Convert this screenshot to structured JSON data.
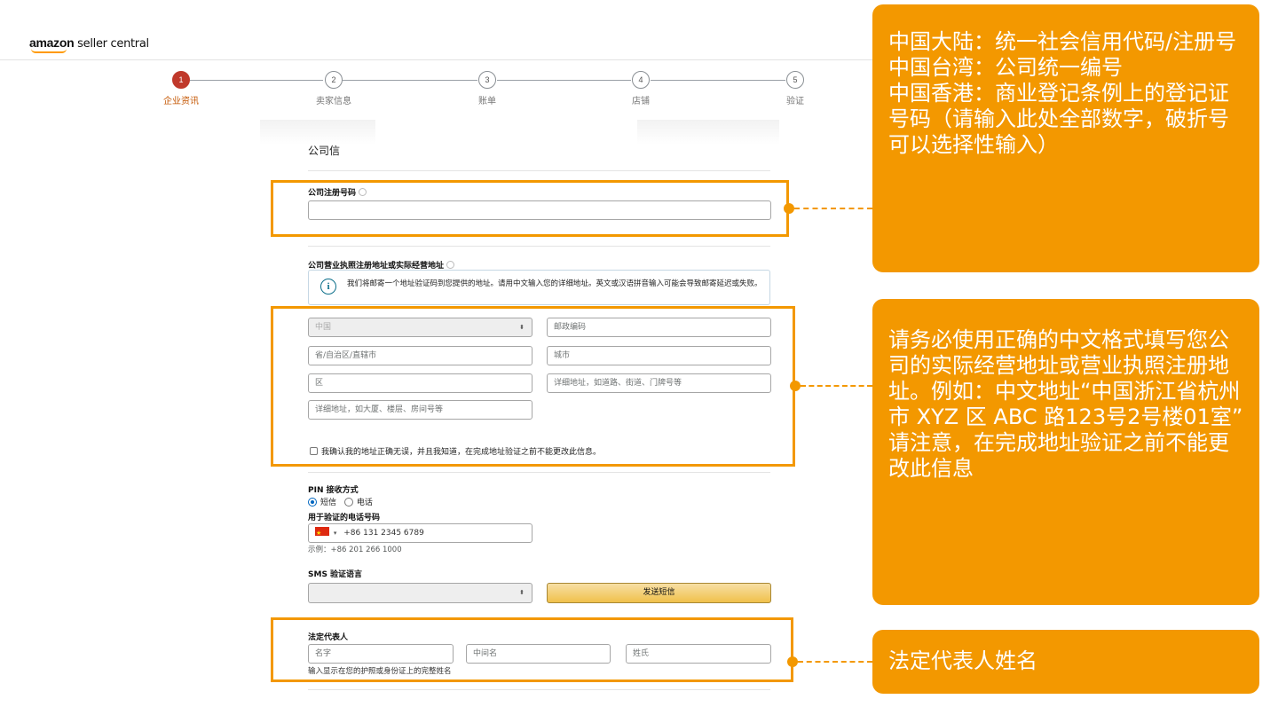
{
  "header": {
    "logo_brand": "amazon",
    "logo_rest": " seller central"
  },
  "stepper": {
    "steps": [
      {
        "num": "1",
        "label": "企业资讯",
        "active": true
      },
      {
        "num": "2",
        "label": "卖家信息",
        "active": false
      },
      {
        "num": "3",
        "label": "账单",
        "active": false
      },
      {
        "num": "4",
        "label": "店铺",
        "active": false
      },
      {
        "num": "5",
        "label": "验证",
        "active": false
      }
    ]
  },
  "form": {
    "section_title": "公司信",
    "registration_label": "公司注册号码",
    "registration_value": "",
    "address_label": "公司营业执照注册地址或实际经营地址",
    "info_message": "我们将邮寄一个地址验证码到您提供的地址。请用中文输入您的详细地址。英文或汉语拼音输入可能会导致邮寄延迟或失败。",
    "country_value": "中国",
    "postal_placeholder": "邮政编码",
    "province_placeholder": "省/自治区/直辖市",
    "city_placeholder": "城市",
    "district_placeholder": "区",
    "street_placeholder": "详细地址，如道路、街道、门牌号等",
    "building_placeholder": "详细地址，如大厦、楼层、房间号等",
    "confirm_checkbox": "我确认我的地址正确无误，并且我知道，在完成地址验证之前不能更改此信息。",
    "pin_label": "PIN 接收方式",
    "pin_options": [
      "短信",
      "电话"
    ],
    "phone_label": "用于验证的电话号码",
    "phone_value": "+86 131 2345 6789",
    "phone_example": "示例：+86 201 266 1000",
    "sms_lang_label": "SMS 验证语言",
    "sms_lang_value": "",
    "send_button": "发送短信",
    "legal_rep_label": "法定代表人",
    "first_name_placeholder": "名字",
    "middle_name_placeholder": "中间名",
    "last_name_placeholder": "姓氏",
    "name_hint": "输入显示在您的护照或身份证上的完整姓名"
  },
  "callouts": {
    "registration": "中国大陆：统一社会信用代码/注册号\n中国台湾：公司统一编号\n中国香港：商业登记条例上的登记证号码（请输入此处全部数字，破折号可以选择性输入）",
    "address": "请务必使用正确的中文格式填写您公司的实际经营地址或营业执照注册地址。例如：中文地址“中国浙江省杭州市 XYZ 区 ABC 路123号2号楼01室”\n请注意，在完成地址验证之前不能更改此信息",
    "legal_rep": "法定代表人姓名"
  },
  "colors": {
    "highlight": "#f39800",
    "active_step": "#c0392b",
    "link": "#0066c0"
  }
}
